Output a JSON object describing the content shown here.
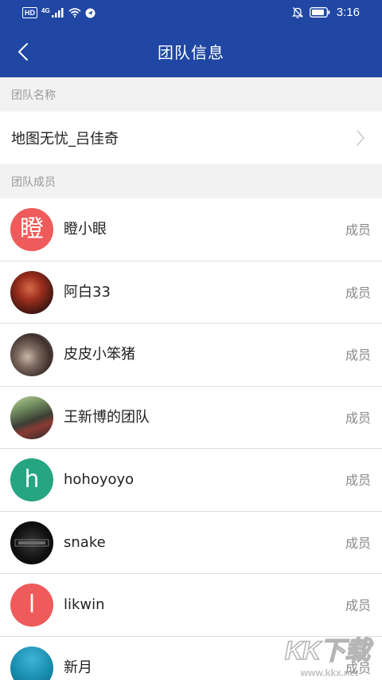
{
  "status_bar": {
    "hd": "HD",
    "network": "4G",
    "time": "3:16",
    "icons": [
      "signal-icon",
      "wifi-icon",
      "location-icon",
      "mute-bell-icon",
      "battery-icon"
    ]
  },
  "navbar": {
    "title": "团队信息",
    "back_icon": "chevron-left-icon"
  },
  "sections": {
    "team_name_header": "团队名称",
    "members_header": "团队成员"
  },
  "team": {
    "name": "地图无忧_吕佳奇"
  },
  "members": [
    {
      "name": "瞪小眼",
      "role": "成员",
      "avatar_letter": "瞪",
      "avatar_color": "#ef5b5b"
    },
    {
      "name": "阿白33",
      "role": "成员",
      "avatar_letter": "",
      "avatar_color": "#8a2b1d"
    },
    {
      "name": "皮皮小笨猪",
      "role": "成员",
      "avatar_letter": "",
      "avatar_color": "#5a4a45"
    },
    {
      "name": "王新博的团队",
      "role": "成员",
      "avatar_letter": "",
      "avatar_color": "#4f6b4a"
    },
    {
      "name": "hohoyoyo",
      "role": "成员",
      "avatar_letter": "h",
      "avatar_color": "#26a582"
    },
    {
      "name": "snake",
      "role": "成员",
      "avatar_letter": "",
      "avatar_color": "#0b0b0b"
    },
    {
      "name": "likwin",
      "role": "成员",
      "avatar_letter": "l",
      "avatar_color": "#ef5b5b"
    },
    {
      "name": "新月",
      "role": "成员",
      "avatar_letter": "",
      "avatar_color": "#1a8fb0"
    }
  ],
  "watermark": {
    "text": "KK下载",
    "url": "www.kkx.net"
  },
  "colors": {
    "primary": "#1f47a3",
    "section_bg": "#f2f2f2",
    "divider": "#dedede"
  }
}
